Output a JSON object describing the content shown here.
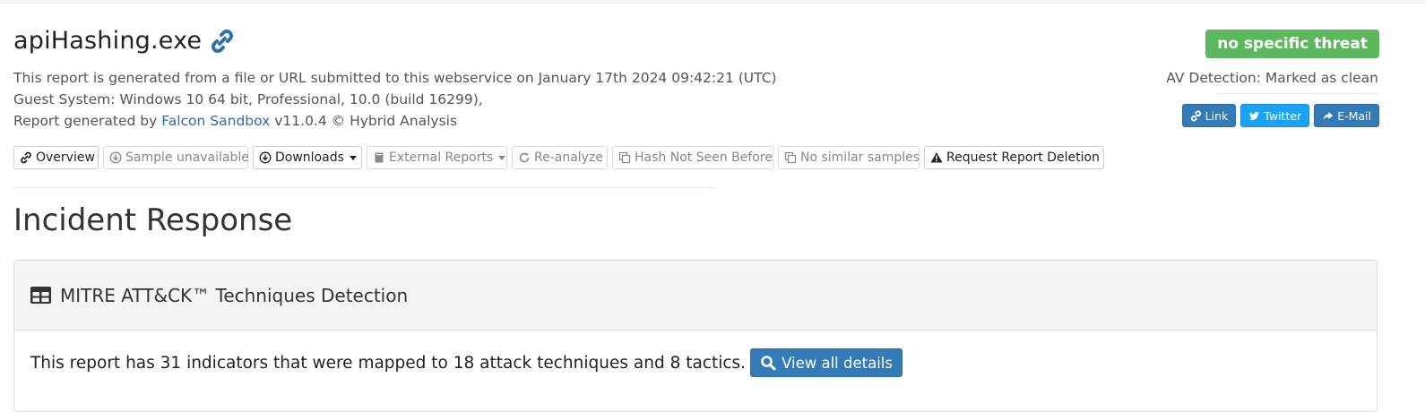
{
  "header": {
    "file_name": "apiHashing.exe",
    "link_icon": "link-icon",
    "report_line": "This report is generated from a file or URL submitted to this webservice on January 17th 2024 09:42:21 (UTC)",
    "guest_system": "Guest System: Windows 10 64 bit, Professional, 10.0 (build 16299),",
    "generated_prefix": "Report generated by ",
    "generator_link": "Falcon Sandbox",
    "generated_suffix": " v11.0.4 © Hybrid Analysis"
  },
  "verdict": {
    "badge": "no specific threat",
    "badge_color": "#5cb85c",
    "av_detection": "AV Detection: Marked as clean"
  },
  "share": {
    "link": "Link",
    "twitter": "Twitter",
    "email": "E-Mail"
  },
  "toolbar": {
    "overview": "Overview",
    "sample_unavailable": "Sample unavailable",
    "downloads": "Downloads",
    "external_reports": "External Reports",
    "reanalyze": "Re-analyze",
    "hash_not_seen": "Hash Not Seen Before",
    "no_similar": "No similar samples",
    "request_deletion": "Request Report Deletion"
  },
  "section": {
    "title": "Incident Response"
  },
  "mitre": {
    "heading": "MITRE ATT&CK™ Techniques Detection",
    "summary": "This report has 31 indicators that were mapped to 18 attack techniques and 8 tactics.",
    "view_details": "View all details"
  },
  "colors": {
    "primary": "#337ab7",
    "twitter": "#1da1f2",
    "success": "#5cb85c"
  }
}
